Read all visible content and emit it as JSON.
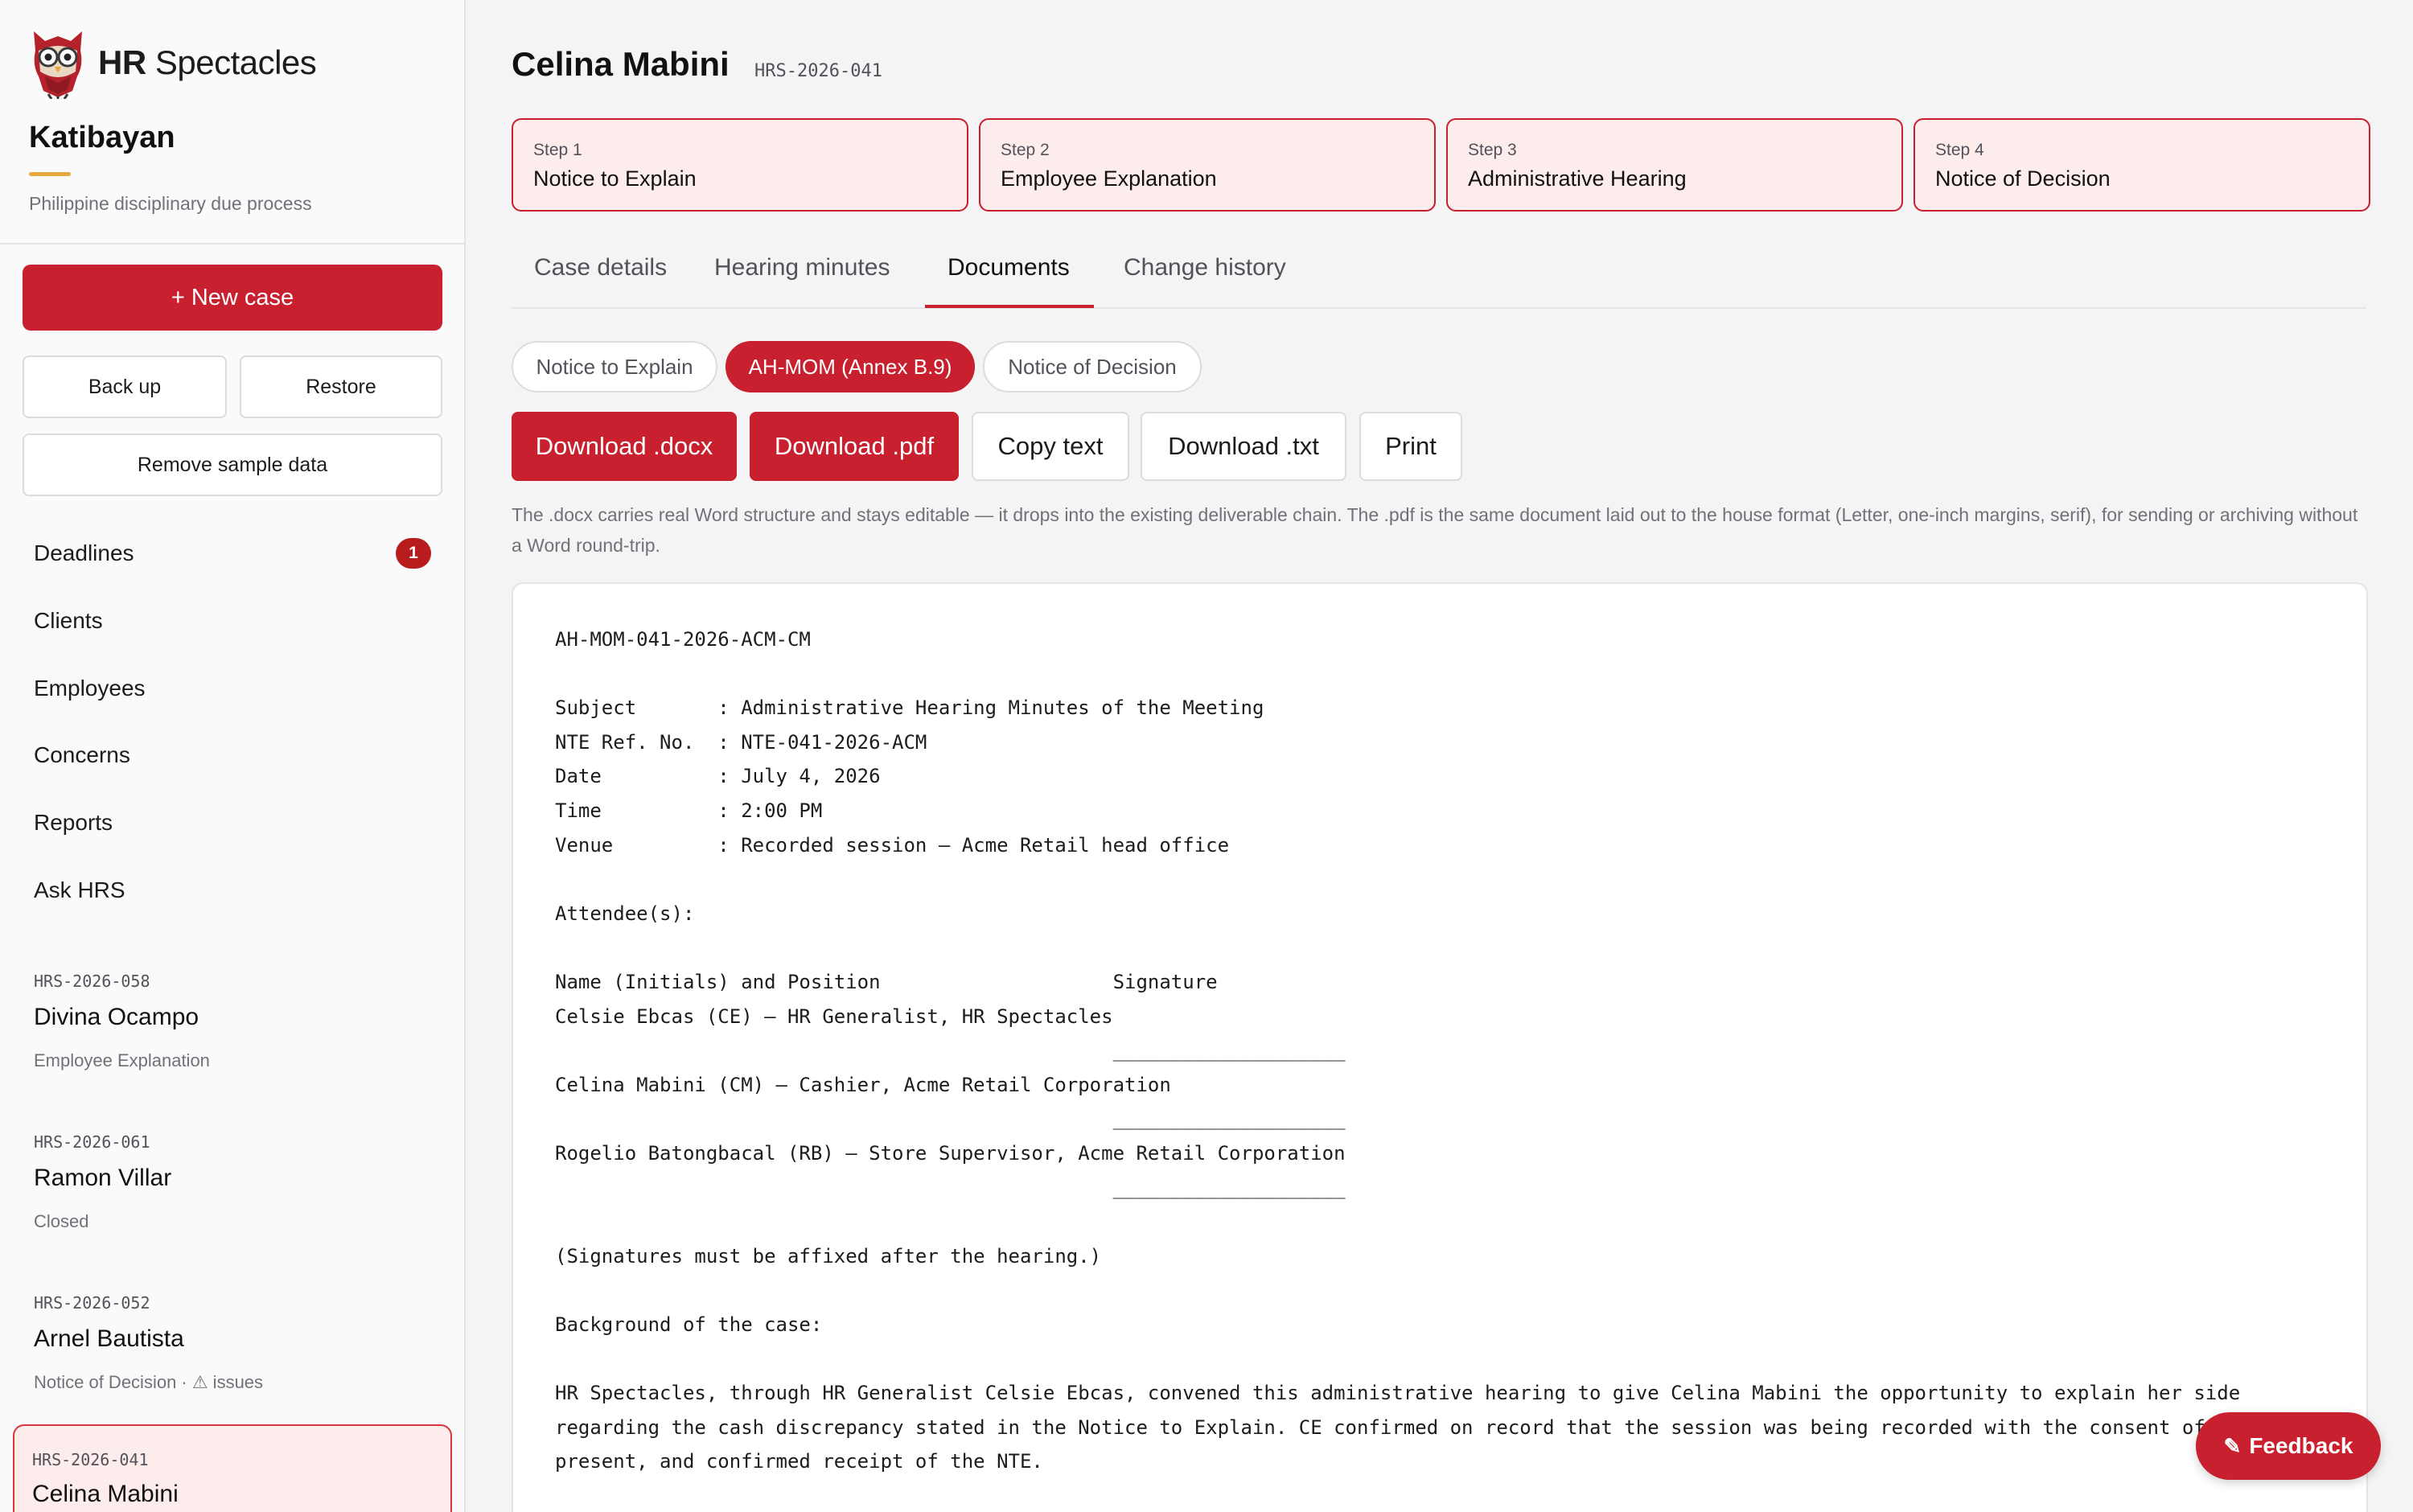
{
  "brand": {
    "logo_bold": "HR",
    "logo_rest": "Spectacles"
  },
  "app": {
    "name": "Katibayan",
    "subtitle": "Philippine disciplinary due process"
  },
  "sidebar": {
    "new_case": "+ New case",
    "backup": "Back up",
    "restore": "Restore",
    "remove_sample": "Remove sample data",
    "nav": [
      {
        "label": "Deadlines",
        "badge": "1"
      },
      {
        "label": "Clients"
      },
      {
        "label": "Employees"
      },
      {
        "label": "Concerns"
      },
      {
        "label": "Reports"
      },
      {
        "label": "Ask HRS"
      }
    ],
    "cases": [
      {
        "id": "HRS-2026-058",
        "name": "Divina Ocampo",
        "status": "Employee Explanation"
      },
      {
        "id": "HRS-2026-061",
        "name": "Ramon Villar",
        "status": "Closed"
      },
      {
        "id": "HRS-2026-052",
        "name": "Arnel Bautista",
        "status": "Notice of Decision · ⚠ issues"
      },
      {
        "id": "HRS-2026-041",
        "name": "Celina Mabini",
        "status": ""
      }
    ]
  },
  "header": {
    "title": "Celina Mabini",
    "case_id": "HRS-2026-041"
  },
  "steps": [
    {
      "num": "Step 1",
      "label": "Notice to Explain"
    },
    {
      "num": "Step 2",
      "label": "Employee Explanation"
    },
    {
      "num": "Step 3",
      "label": "Administrative Hearing"
    },
    {
      "num": "Step 4",
      "label": "Notice of Decision"
    }
  ],
  "tabs": [
    "Case details",
    "Hearing minutes",
    "Documents",
    "Change history"
  ],
  "active_tab": "Documents",
  "doc_pills": [
    "Notice to Explain",
    "AH-MOM (Annex B.9)",
    "Notice of Decision"
  ],
  "active_pill": "AH-MOM (Annex B.9)",
  "actions": {
    "docx": "Download .docx",
    "pdf": "Download .pdf",
    "copy": "Copy text",
    "txt": "Download .txt",
    "print": "Print"
  },
  "note": "The .docx carries real Word structure and stays editable — it drops into the existing deliverable chain. The .pdf is the same document laid out to the house format (Letter, one-inch margins, serif), for sending or archiving without a Word round-trip.",
  "document": {
    "ref": "AH-MOM-041-2026-ACM-CM",
    "fields": [
      "Subject       : Administrative Hearing Minutes of the Meeting",
      "NTE Ref. No.  : NTE-041-2026-ACM",
      "Date          : July 4, 2026",
      "Time          : 2:00 PM",
      "Venue         : Recorded session — Acme Retail head office"
    ],
    "attendees_heading": "Attendee(s):",
    "sig_header": "Name (Initials) and Position                    Signature",
    "attendees": [
      "Celsie Ebcas (CE) — HR Generalist, HR Spectacles",
      "Celina Mabini (CM) — Cashier, Acme Retail Corporation",
      "Rogelio Batongbacal (RB) — Store Supervisor, Acme Retail Corporation"
    ],
    "sig_line": "                                                ____________________",
    "sig_note": "(Signatures must be affixed after the hearing.)",
    "background_heading": "Background of the case:",
    "background_lines": [
      "HR Spectacles, through HR Generalist Celsie Ebcas, convened this administrative hearing to give Celina Mabini the opportunity to explain her side",
      "regarding the cash discrepancy stated in the Notice to Explain. CE confirmed on record that the session was being recorded with the consent of all",
      "present, and confirmed receipt of the NTE."
    ]
  },
  "feedback": "Feedback"
}
